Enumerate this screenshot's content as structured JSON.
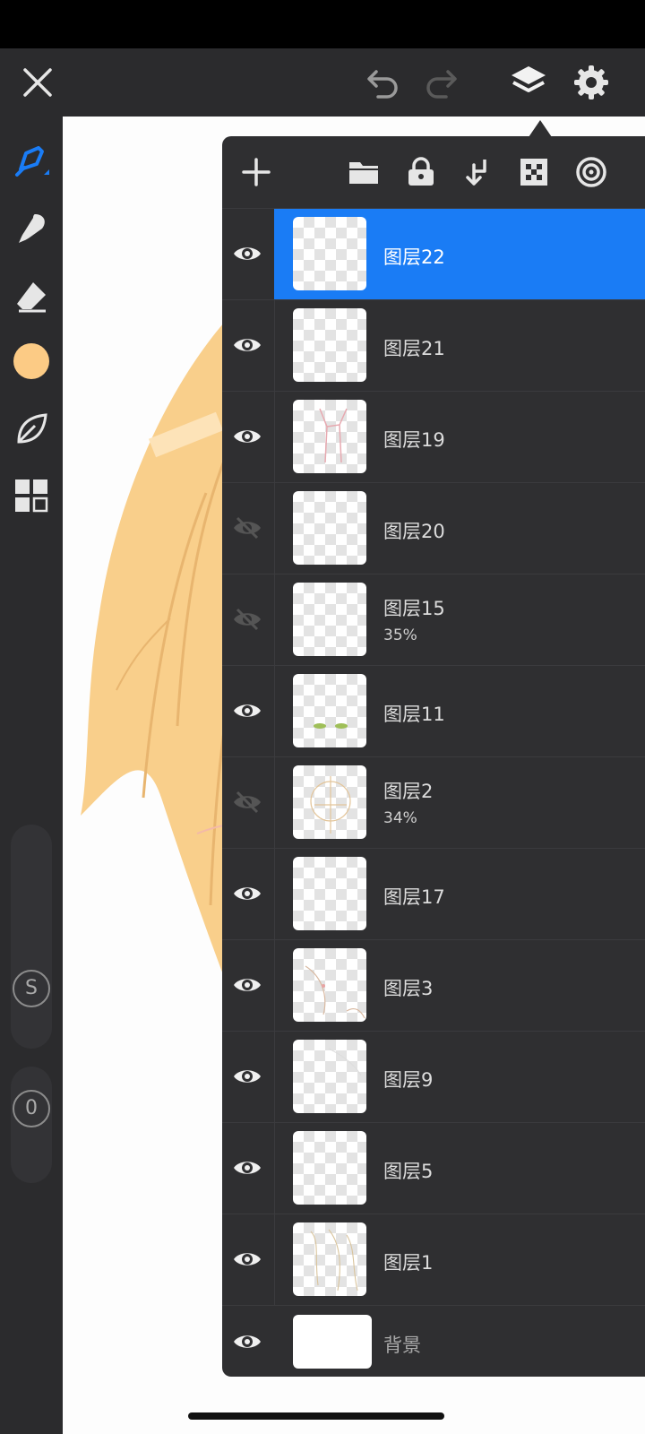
{
  "icons": {
    "close": "close-icon",
    "undo": "undo-icon",
    "redo": "redo-icon",
    "layers": "layers-icon",
    "settings": "gear-icon"
  },
  "colors": {
    "accent": "#1a7cf5",
    "current_brush_color": "#fccb85",
    "panel_bg": "#2f2f31",
    "toolbar_bg": "#2b2b2d"
  },
  "left_toolbar": {
    "tools": [
      "brush-icon",
      "smudge-icon",
      "eraser-icon",
      "color-swatch",
      "leaf-icon",
      "gallery-icon"
    ],
    "size_slider_label": "S",
    "opacity_slider_label": "0"
  },
  "layers_panel": {
    "toolbar": [
      "add-layer-icon",
      "folder-icon",
      "lock-icon",
      "merge-down-icon",
      "checker-icon",
      "target-icon"
    ],
    "layers": [
      {
        "name": "图层22",
        "opacity": "",
        "visible": true,
        "selected": true
      },
      {
        "name": "图层21",
        "opacity": "",
        "visible": true,
        "selected": false
      },
      {
        "name": "图层19",
        "opacity": "",
        "visible": true,
        "selected": false
      },
      {
        "name": "图层20",
        "opacity": "",
        "visible": false,
        "selected": false
      },
      {
        "name": "图层15",
        "opacity": "35%",
        "visible": false,
        "selected": false
      },
      {
        "name": "图层11",
        "opacity": "",
        "visible": true,
        "selected": false
      },
      {
        "name": "图层2",
        "opacity": "34%",
        "visible": false,
        "selected": false
      },
      {
        "name": "图层17",
        "opacity": "",
        "visible": true,
        "selected": false
      },
      {
        "name": "图层3",
        "opacity": "",
        "visible": true,
        "selected": false
      },
      {
        "name": "图层9",
        "opacity": "",
        "visible": true,
        "selected": false
      },
      {
        "name": "图层5",
        "opacity": "",
        "visible": true,
        "selected": false
      },
      {
        "name": "图层1",
        "opacity": "",
        "visible": true,
        "selected": false
      }
    ],
    "background_layer": {
      "name": "背景",
      "visible": true
    }
  }
}
